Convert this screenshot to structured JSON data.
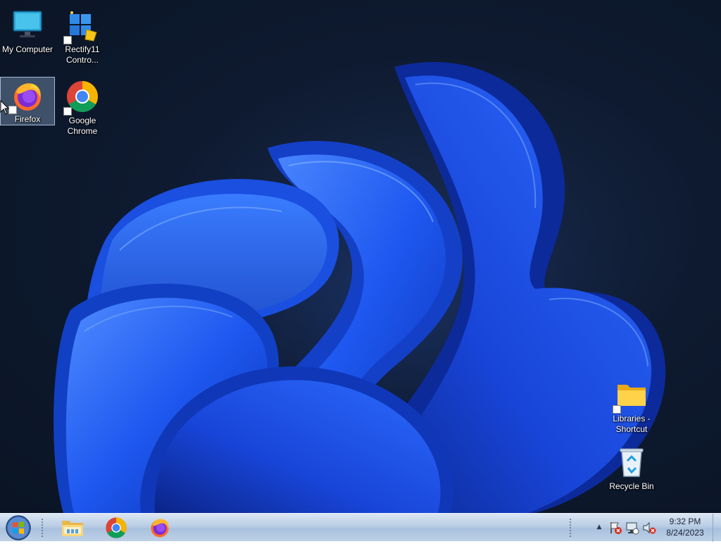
{
  "desktop": {
    "icons": [
      {
        "label": "My Computer",
        "icon": "computer-icon"
      },
      {
        "label": "Rectify11 Contro...",
        "icon": "control-panel-icon"
      },
      {
        "label": "Firefox",
        "icon": "firefox-icon",
        "selected": true
      },
      {
        "label": "Google Chrome",
        "icon": "chrome-icon"
      },
      {
        "label": "Libraries - Shortcut",
        "icon": "folder-icon"
      },
      {
        "label": "Recycle Bin",
        "icon": "recycle-bin-icon"
      }
    ]
  },
  "taskbar": {
    "start": {
      "icon": "windows-start-icon"
    },
    "pinned": [
      {
        "name": "File Explorer",
        "icon": "file-explorer-icon"
      },
      {
        "name": "Google Chrome",
        "icon": "chrome-icon"
      },
      {
        "name": "Firefox",
        "icon": "firefox-icon"
      }
    ],
    "tray": {
      "expand_icon": "chevron-up-icon",
      "icons": [
        "action-center-warning-icon",
        "network-icon",
        "volume-muted-icon"
      ]
    },
    "clock": {
      "time": "9:32 PM",
      "date": "8/24/2023"
    }
  },
  "colors": {
    "wallpaper_dark": "#0a1424",
    "bloom_blue": "#1e58f0",
    "taskbar": "#b9cde5"
  }
}
